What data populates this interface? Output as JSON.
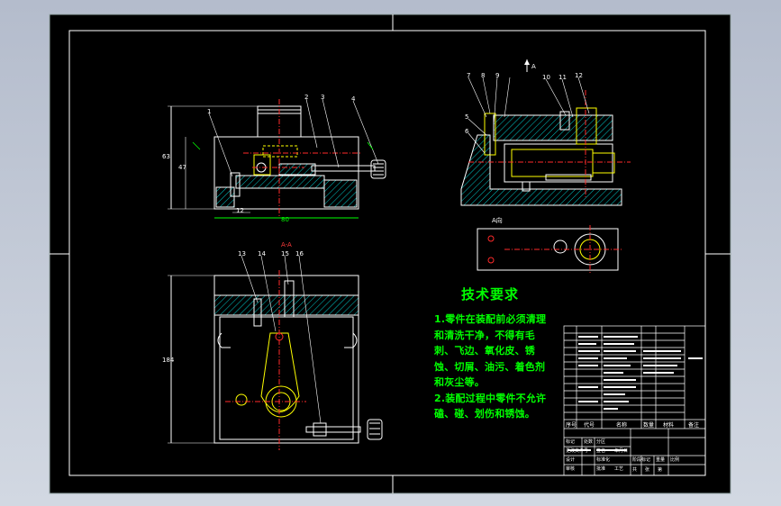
{
  "drawing": {
    "colors": {
      "background_outer": "#b4bccc",
      "sheet": "#000000",
      "lines": "#ffffff",
      "hatch": "#00c8c8",
      "centerline": "#ff2a2a",
      "dimension": "#00ff00",
      "part": "#ffff00",
      "title_text": "#ffffff"
    },
    "views": {
      "front_view_label": "",
      "section_label": "A-A",
      "direction_label": "A向",
      "arrow_label": "A"
    },
    "part_numbers": {
      "front": [
        "1",
        "2",
        "3",
        "4"
      ],
      "side": [
        "5",
        "6",
        "7",
        "8",
        "9",
        "10",
        "11",
        "12"
      ],
      "section": [
        "13",
        "14",
        "15",
        "16"
      ]
    },
    "dimensions": {
      "front_width": "80",
      "front_height": "63",
      "front_sub": "47",
      "front_bottom": "12",
      "section_height": "184"
    },
    "tech_requirements": {
      "title": "技术要求",
      "items": [
        "1.零件在装配前必须清理和清洗干净，不得有毛刺、飞边、氧化皮、锈蚀、切屑、油污、着色剂和灰尘等。",
        "2.装配过程中零件不允许磕、碰、划伤和锈蚀。"
      ]
    },
    "title_block": {
      "header": [
        "序号",
        "代号",
        "名称",
        "数量",
        "材料",
        "备注"
      ],
      "labels": [
        "标记",
        "处数",
        "分区",
        "更改文件号",
        "签名",
        "年月日",
        "设计",
        "标准化",
        "审核",
        "工艺",
        "批准",
        "阶段标记",
        "重量",
        "比例",
        "共",
        "张",
        "第"
      ]
    }
  }
}
